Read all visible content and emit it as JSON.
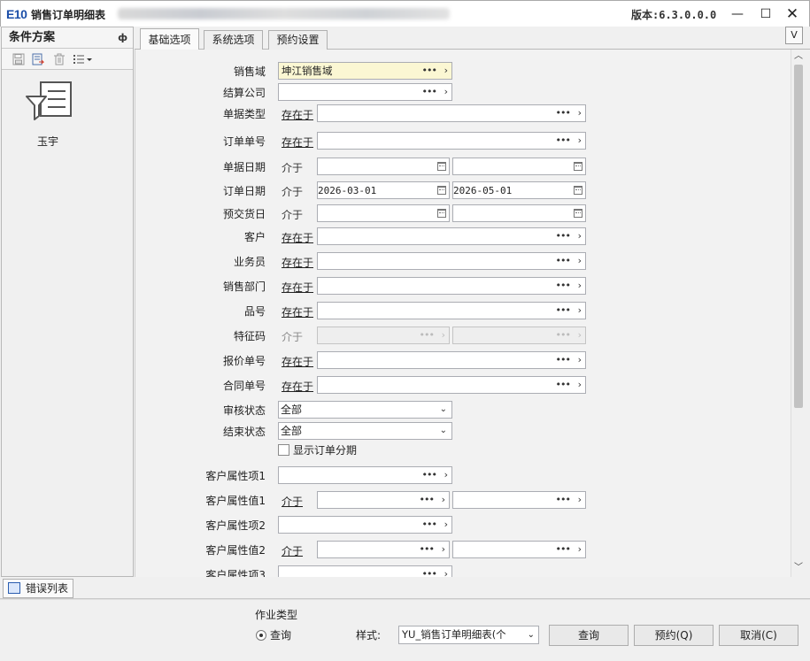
{
  "window": {
    "logo": "E10",
    "title": "销售订单明细表",
    "version": "版本:6.3.0.0.0",
    "min": "—",
    "max": "☐",
    "close": "✕"
  },
  "left_panel": {
    "title": "条件方案",
    "pin": "ф",
    "item_label": "玉宇"
  },
  "tabs": [
    "基础选项",
    "系统选项",
    "预约设置"
  ],
  "v_button": "V",
  "form": {
    "rows": [
      {
        "label": "销售域",
        "value": "坤江销售域"
      },
      {
        "label": "结算公司",
        "value": ""
      },
      {
        "label": "单据类型",
        "op": "存在于",
        "value": ""
      },
      {
        "label": "订单单号",
        "op": "存在于",
        "value": ""
      },
      {
        "label": "单据日期",
        "op": "介于",
        "from": "",
        "to": ""
      },
      {
        "label": "订单日期",
        "op": "介于",
        "from": "2026-03-01",
        "to": "2026-05-01"
      },
      {
        "label": "预交货日",
        "op": "介于",
        "from": "",
        "to": ""
      },
      {
        "label": "客户",
        "op": "存在于",
        "value": ""
      },
      {
        "label": "业务员",
        "op": "存在于",
        "value": ""
      },
      {
        "label": "销售部门",
        "op": "存在于",
        "value": ""
      },
      {
        "label": "品号",
        "op": "存在于",
        "value": ""
      },
      {
        "label": "特征码",
        "op": "介于",
        "from": "",
        "to": ""
      },
      {
        "label": "报价单号",
        "op": "存在于",
        "value": ""
      },
      {
        "label": "合同单号",
        "op": "存在于",
        "value": ""
      },
      {
        "label": "审核状态",
        "value": "全部"
      },
      {
        "label": "结束状态",
        "value": "全部"
      },
      {
        "label": "客户属性项1",
        "value": ""
      },
      {
        "label": "客户属性值1",
        "op": "介于",
        "from": "",
        "to": ""
      },
      {
        "label": "客户属性项2",
        "value": ""
      },
      {
        "label": "客户属性值2",
        "op": "介于",
        "from": "",
        "to": ""
      },
      {
        "label": "客户属性项3",
        "value": ""
      }
    ],
    "checkbox_label": "显示订单分期"
  },
  "bottom_tab": "错误列表",
  "footer": {
    "job_type": "作业类型",
    "radio_query": "查询",
    "style_label": "样式:",
    "style_value": "YU_销售订单明细表(个",
    "btn_query": "查询",
    "btn_reserve": "预约(Q)",
    "btn_cancel": "取消(C)"
  }
}
